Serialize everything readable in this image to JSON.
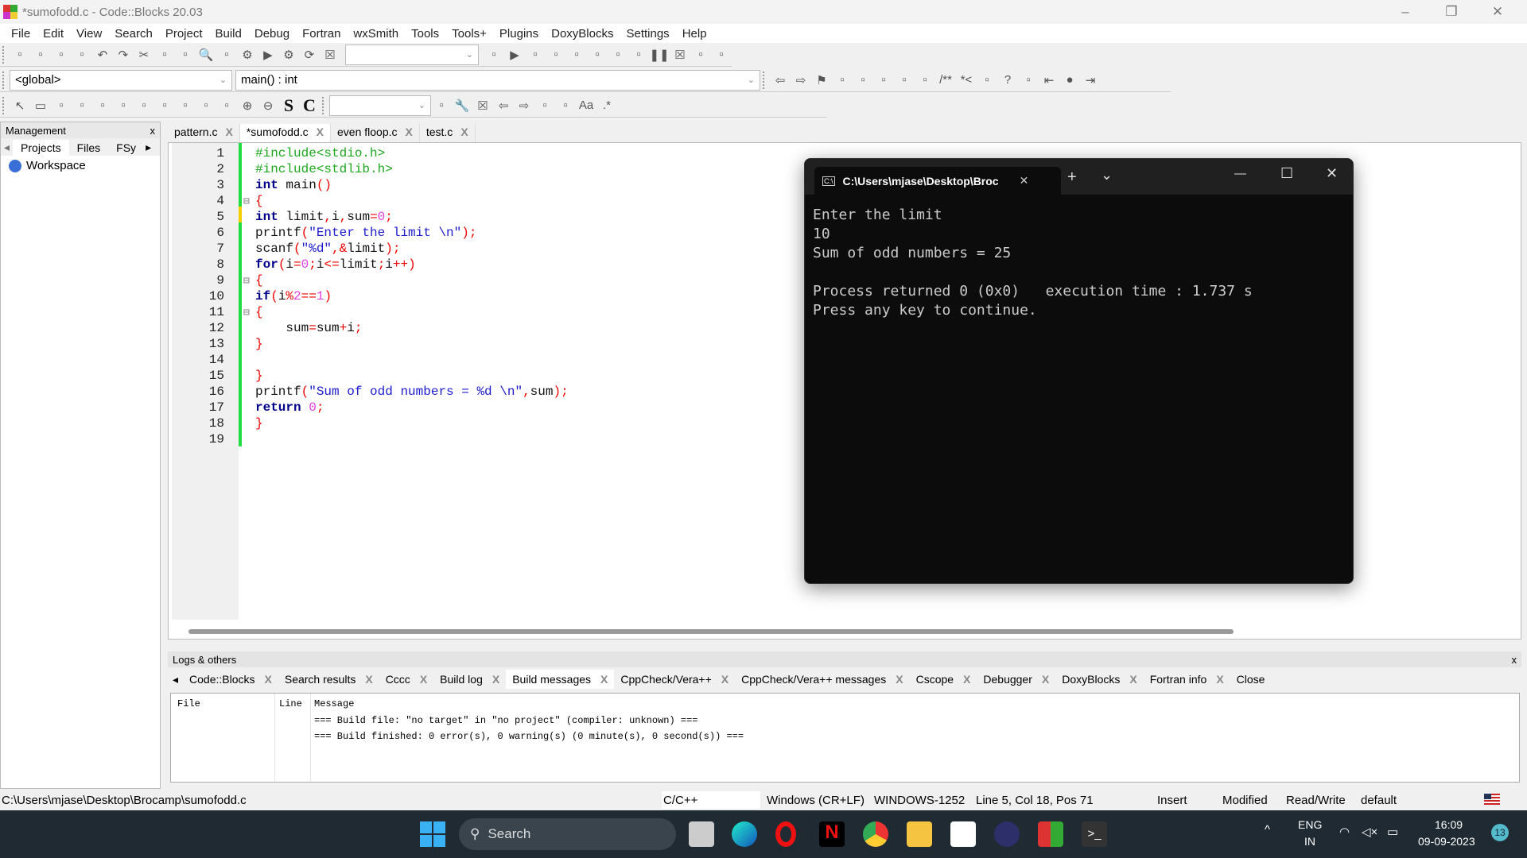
{
  "window": {
    "title": "*sumofodd.c - Code::Blocks 20.03",
    "minimize": "–",
    "restore": "❐",
    "close": "✕"
  },
  "menu": [
    "File",
    "Edit",
    "View",
    "Search",
    "Project",
    "Build",
    "Debug",
    "Fortran",
    "wxSmith",
    "Tools",
    "Tools+",
    "Plugins",
    "DoxyBlocks",
    "Settings",
    "Help"
  ],
  "toolbar": {
    "scope_combo": "<global>",
    "function_combo": "main() : int",
    "icons1": [
      "new-file",
      "open",
      "save",
      "save-all",
      "undo",
      "redo",
      "cut",
      "copy",
      "paste",
      "find",
      "replace",
      "build-settings",
      "run",
      "build",
      "rebuild",
      "abort"
    ],
    "icons1b": [
      "build-target-info",
      "debug-run",
      "run-to-cursor",
      "next-line",
      "step-into",
      "step-out",
      "next-instruction",
      "step-into-instruction",
      "break",
      "stop-debug",
      "debug-windows",
      "info"
    ],
    "icons2": [
      "jump-back",
      "jump-forward",
      "toggle-bookmark",
      "prev-bookmark",
      "next-bookmark",
      "clear-bookmarks",
      "doxy-wizard",
      "doxy-extract",
      "comment-block",
      "comment-line",
      "run-html",
      "run-chm",
      "doxy-config",
      "prev-change",
      "change",
      "next-change"
    ],
    "icons3": [
      "select",
      "rect",
      "decision",
      "else-if",
      "loop",
      "loop2",
      "block",
      "block2",
      "break-node",
      "continue-node",
      "return-node",
      "zoom-in",
      "zoom-out"
    ],
    "s_label": "S",
    "c_label": "C",
    "icons3b": [
      "find-all",
      "settings-wrench",
      "clear",
      "highlight-prev",
      "highlight-next",
      "highlight",
      "selected-text",
      "match-case",
      "regex"
    ]
  },
  "management": {
    "title": "Management",
    "close": "x",
    "tabs": [
      "Projects",
      "Files",
      "FSy"
    ],
    "workspace": "Workspace"
  },
  "editor": {
    "tabs": [
      {
        "label": "pattern.c"
      },
      {
        "label": "*sumofodd.c",
        "active": true
      },
      {
        "label": "even floop.c"
      },
      {
        "label": "test.c"
      }
    ],
    "close": "X",
    "lines": [
      [
        [
          "pp",
          "#include<stdio.h>"
        ]
      ],
      [
        [
          "pp",
          "#include<stdlib.h>"
        ]
      ],
      [
        [
          "kw",
          "int"
        ],
        [
          "id",
          " main"
        ],
        [
          "op",
          "()"
        ]
      ],
      [
        [
          "op",
          "{"
        ]
      ],
      [
        [
          "kw",
          "int"
        ],
        [
          "id",
          " limit"
        ],
        [
          "op",
          ","
        ],
        [
          "id",
          "i"
        ],
        [
          "op",
          ","
        ],
        [
          "id",
          "sum"
        ],
        [
          "op",
          "="
        ],
        [
          "num",
          "0"
        ],
        [
          "op",
          ";"
        ]
      ],
      [
        [
          "id",
          "printf"
        ],
        [
          "op",
          "("
        ],
        [
          "str",
          "\"Enter the limit \\n\""
        ],
        [
          "op",
          ");"
        ]
      ],
      [
        [
          "id",
          "scanf"
        ],
        [
          "op",
          "("
        ],
        [
          "str",
          "\"%d\""
        ],
        [
          "op",
          ",&"
        ],
        [
          "id",
          "limit"
        ],
        [
          "op",
          ");"
        ]
      ],
      [
        [
          "kw",
          "for"
        ],
        [
          "op",
          "("
        ],
        [
          "id",
          "i"
        ],
        [
          "op",
          "="
        ],
        [
          "num",
          "0"
        ],
        [
          "op",
          ";"
        ],
        [
          "id",
          "i"
        ],
        [
          "op",
          "<="
        ],
        [
          "id",
          "limit"
        ],
        [
          "op",
          ";"
        ],
        [
          "id",
          "i"
        ],
        [
          "op",
          "++)"
        ]
      ],
      [
        [
          "op",
          "{"
        ]
      ],
      [
        [
          "kw",
          "if"
        ],
        [
          "op",
          "("
        ],
        [
          "id",
          "i"
        ],
        [
          "op",
          "%"
        ],
        [
          "num",
          "2"
        ],
        [
          "op",
          "=="
        ],
        [
          "num",
          "1"
        ],
        [
          "op",
          ")"
        ]
      ],
      [
        [
          "op",
          "{"
        ]
      ],
      [
        [
          "id",
          "    sum"
        ],
        [
          "op",
          "="
        ],
        [
          "id",
          "sum"
        ],
        [
          "op",
          "+"
        ],
        [
          "id",
          "i"
        ],
        [
          "op",
          ";"
        ]
      ],
      [
        [
          "op",
          "}"
        ]
      ],
      [],
      [
        [
          "op",
          "}"
        ]
      ],
      [
        [
          "id",
          "printf"
        ],
        [
          "op",
          "("
        ],
        [
          "str",
          "\"Sum of odd numbers = %d \\n\""
        ],
        [
          "op",
          ","
        ],
        [
          "id",
          "sum"
        ],
        [
          "op",
          ");"
        ]
      ],
      [
        [
          "kw",
          "return"
        ],
        [
          "id",
          " "
        ],
        [
          "num",
          "0"
        ],
        [
          "op",
          ";"
        ]
      ],
      [
        [
          "op",
          "}"
        ]
      ],
      []
    ]
  },
  "terminal": {
    "tab_title": "C:\\Users\\mjase\\Desktop\\Broc",
    "tab_close": "✕",
    "new_tab": "+",
    "dropdown": "⌄",
    "minimize": "—",
    "maximize": "☐",
    "close": "✕",
    "output": [
      "Enter the limit",
      "10",
      "Sum of odd numbers = 25",
      "",
      "Process returned 0 (0x0)   execution time : 1.737 s",
      "Press any key to continue."
    ]
  },
  "logs": {
    "title": "Logs & others",
    "close": "x",
    "tabs": [
      {
        "label": "Code::Blocks"
      },
      {
        "label": "Search results"
      },
      {
        "label": "Cccc"
      },
      {
        "label": "Build log"
      },
      {
        "label": "Build messages",
        "active": true
      },
      {
        "label": "CppCheck/Vera++"
      },
      {
        "label": "CppCheck/Vera++ messages"
      },
      {
        "label": "Cscope"
      },
      {
        "label": "Debugger"
      },
      {
        "label": "DoxyBlocks"
      },
      {
        "label": "Fortran info"
      },
      {
        "label": "Close"
      }
    ],
    "columns": [
      "File",
      "Line",
      "Message"
    ],
    "messages": [
      "=== Build file: \"no target\" in \"no project\" (compiler: unknown) ===",
      "=== Build finished: 0 error(s), 0 warning(s) (0 minute(s), 0 second(s)) ==="
    ]
  },
  "status": {
    "path": "C:\\Users\\mjase\\Desktop\\Brocamp\\sumofodd.c",
    "lang": "C/C++",
    "eol": "Windows (CR+LF)",
    "encoding": "WINDOWS-1252",
    "position": "Line 5, Col 18, Pos 71",
    "mode": "Insert",
    "modified": "Modified",
    "access": "Read/Write",
    "profile": "default"
  },
  "taskbar": {
    "search": "Search",
    "lang1": "ENG",
    "lang2": "IN",
    "time": "16:09",
    "date": "09-09-2023",
    "badge": "13"
  }
}
